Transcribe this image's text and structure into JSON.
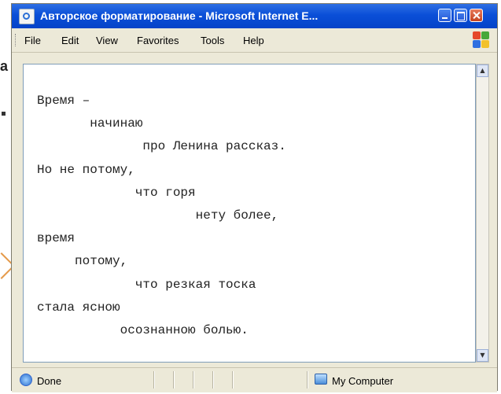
{
  "slide_fragment": {
    "text": "a"
  },
  "window": {
    "title": "Авторское форматирование - Microsoft Internet E...",
    "menu": [
      "File",
      "Edit",
      "View",
      "Favorites",
      "Tools",
      "Help"
    ]
  },
  "content": {
    "poem_lines": [
      "Время –",
      "       начинаю",
      "              про Ленина рассказ.",
      "Но не потому,",
      "             что горя",
      "                     нету более,",
      "время",
      "     потому,",
      "             что резкая тоска",
      "стала ясною",
      "           осознанною болью."
    ]
  },
  "statusbar": {
    "status": "Done",
    "zone": "My Computer"
  },
  "colors": {
    "titlebar": "#0a4fd8",
    "window_face": "#ece9d8",
    "accent_chevron": "#e59a4a"
  },
  "icons": {
    "title": "ie-page-icon",
    "brand": "windows-logo-icon",
    "status": "ie-done-icon",
    "zone": "my-computer-icon"
  }
}
